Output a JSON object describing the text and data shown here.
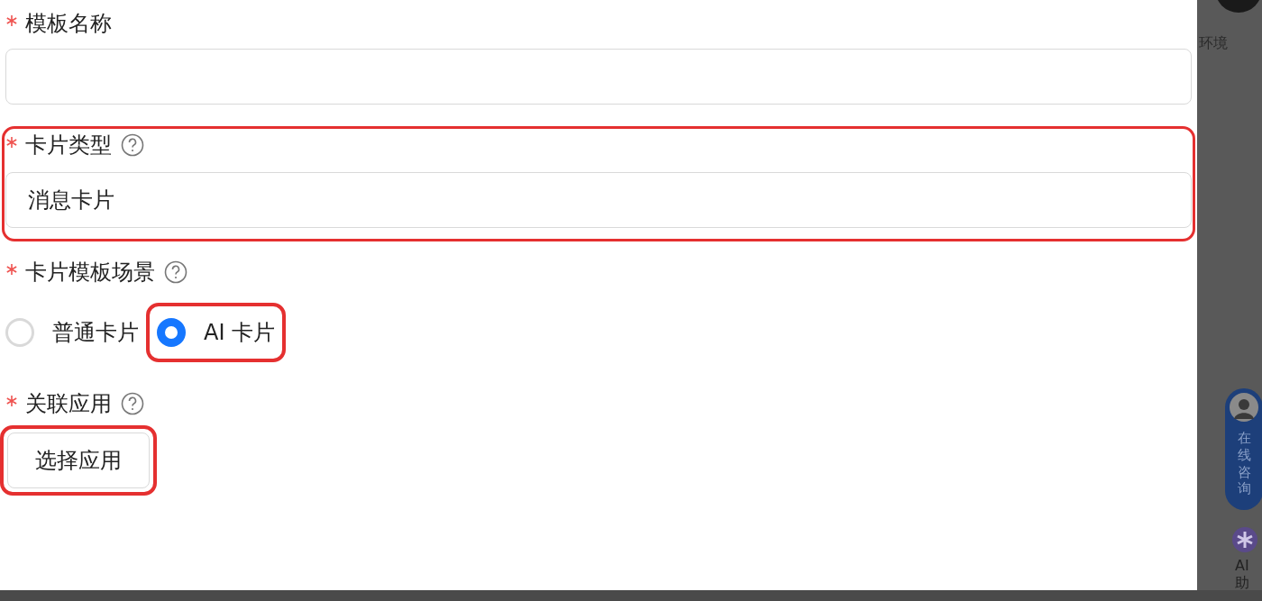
{
  "form": {
    "fields": [
      {
        "kind": "text",
        "label": "模板名称",
        "required": true,
        "help": false,
        "highlighted": false
      },
      {
        "kind": "select",
        "label": "卡片类型",
        "required": true,
        "help": true,
        "highlighted": true,
        "value": "消息卡片"
      },
      {
        "kind": "radio",
        "label": "卡片模板场景",
        "required": true,
        "help": true,
        "highlighted": false,
        "options": [
          {
            "label": "普通卡片",
            "selected": false,
            "highlighted": false
          },
          {
            "label": "AI 卡片",
            "selected": true,
            "highlighted": true
          }
        ]
      },
      {
        "kind": "button",
        "label": "关联应用",
        "required": true,
        "help": true,
        "highlighted": false,
        "button": {
          "label": "选择应用",
          "highlighted": true
        }
      }
    ]
  },
  "side": {
    "env_label": "环境",
    "consult_label": "在线咨询",
    "assistant_label": "AI\n助"
  }
}
